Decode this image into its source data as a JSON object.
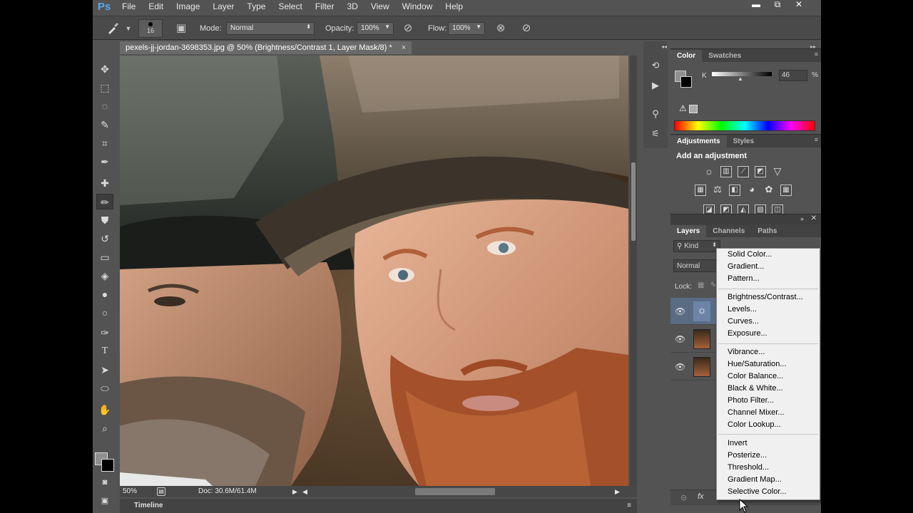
{
  "app": {
    "logo": "Ps"
  },
  "menu": [
    "File",
    "Edit",
    "Image",
    "Layer",
    "Type",
    "Select",
    "Filter",
    "3D",
    "View",
    "Window",
    "Help"
  ],
  "window_controls": {
    "minimize": "▬",
    "restore": "⧉",
    "close": "✕"
  },
  "options": {
    "brush_size": "16",
    "mode_label": "Mode:",
    "mode_value": "Normal",
    "opacity_label": "Opacity:",
    "opacity_value": "100%",
    "flow_label": "Flow:",
    "flow_value": "100%"
  },
  "document": {
    "tab_title": "pexels-jj-jordan-3698353.jpg @ 50% (Brightness/Contrast 1, Layer Mask/8) *",
    "tab_close": "×",
    "zoom": "50%",
    "doc_size": "Doc: 30.6M/61.4M"
  },
  "timeline": {
    "label": "Timeline"
  },
  "color_panel": {
    "tabs": [
      "Color",
      "Swatches"
    ],
    "channel": "K",
    "value": "46",
    "unit": "%"
  },
  "adjustments_panel": {
    "tabs": [
      "Adjustments",
      "Styles"
    ],
    "heading": "Add an adjustment"
  },
  "layers_panel": {
    "tabs": [
      "Layers",
      "Channels",
      "Paths"
    ],
    "filter_kind": "Kind",
    "blend_mode": "Normal",
    "lock_label": "Lock:",
    "footer_link": "⊝",
    "footer_fx": "fx"
  },
  "adjustment_menu": {
    "group1": [
      "Solid Color...",
      "Gradient...",
      "Pattern..."
    ],
    "group2": [
      "Brightness/Contrast...",
      "Levels...",
      "Curves...",
      "Exposure..."
    ],
    "group3": [
      "Vibrance...",
      "Hue/Saturation...",
      "Color Balance...",
      "Black & White...",
      "Photo Filter...",
      "Channel Mixer...",
      "Color Lookup..."
    ],
    "group4": [
      "Invert",
      "Posterize...",
      "Threshold...",
      "Gradient Map...",
      "Selective Color..."
    ]
  },
  "colors": {
    "ui_background": "#535353",
    "panel_dark": "#424242",
    "menu_background": "#f0f0f0",
    "accent_blue": "#59a8e8"
  }
}
